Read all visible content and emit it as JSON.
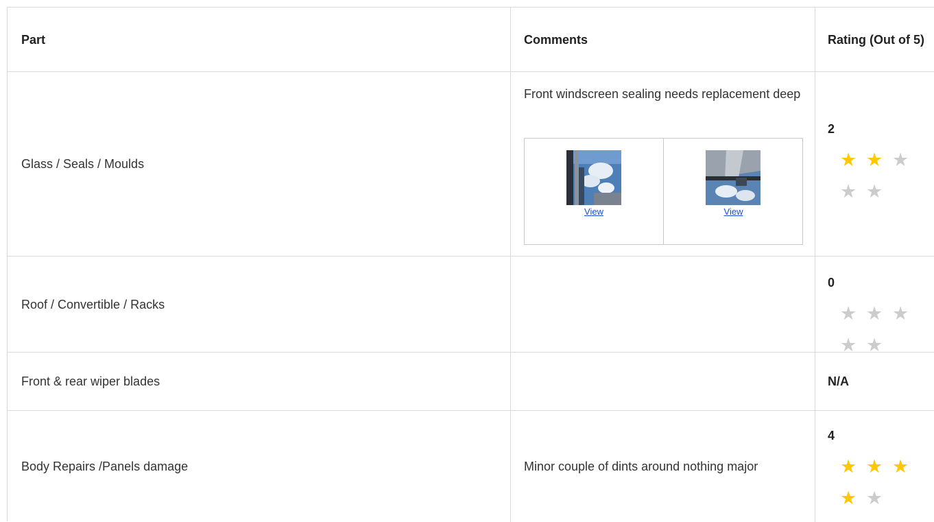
{
  "table": {
    "headers": {
      "part": "Part",
      "comments": "Comments",
      "rating": "Rating (Out of 5)"
    },
    "rows": [
      {
        "part": "Glass / Seals / Moulds",
        "comment": "Front windscreen sealing needs replacement deep",
        "rating": "2",
        "rating_value": 2,
        "photos": [
          {
            "link_label": "View",
            "thumb_icon": "windscreen-photo"
          },
          {
            "link_label": "View",
            "thumb_icon": "windscreen-photo"
          }
        ]
      },
      {
        "part": "Roof / Convertible / Racks",
        "comment": "",
        "rating": "0",
        "rating_value": 0
      },
      {
        "part": "Front & rear wiper blades",
        "comment": "",
        "rating": "N/A"
      },
      {
        "part": "Body Repairs /Panels damage",
        "comment": "Minor couple of dints around nothing major",
        "rating": "4",
        "rating_value": 4
      }
    ],
    "max_stars": 5
  },
  "colors": {
    "star_filled": "#ffc800",
    "star_empty": "#cccccc",
    "link": "#1a4fcf",
    "border": "#d9d9d9"
  }
}
